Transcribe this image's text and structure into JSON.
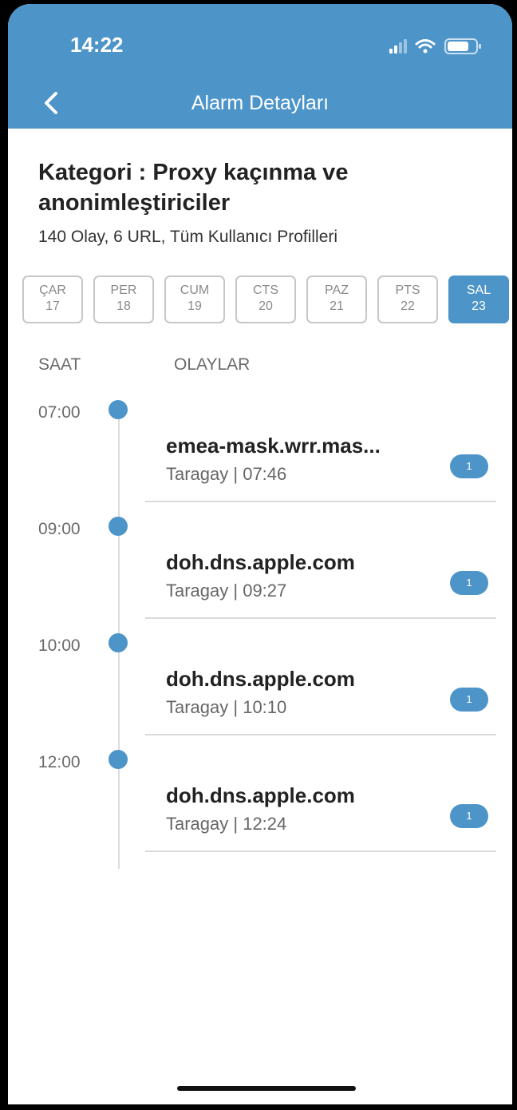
{
  "status_bar": {
    "time": "14:22"
  },
  "nav": {
    "title": "Alarm Detayları"
  },
  "category": {
    "title": "Kategori : Proxy kaçınma ve anonimleştiriciler",
    "summary": "140 Olay, 6 URL, Tüm Kullanıcı Profilleri"
  },
  "days": [
    {
      "name": "ÇAR",
      "num": "17",
      "selected": false
    },
    {
      "name": "PER",
      "num": "18",
      "selected": false
    },
    {
      "name": "CUM",
      "num": "19",
      "selected": false
    },
    {
      "name": "CTS",
      "num": "20",
      "selected": false
    },
    {
      "name": "PAZ",
      "num": "21",
      "selected": false
    },
    {
      "name": "PTS",
      "num": "22",
      "selected": false
    },
    {
      "name": "SAL",
      "num": "23",
      "selected": true
    }
  ],
  "columns": {
    "time": "SAAT",
    "events": "OLAYLAR"
  },
  "entries": [
    {
      "hour": "07:00",
      "domain": "emea-mask.wrr.mas...",
      "meta": "Taragay | 07:46",
      "count": "1"
    },
    {
      "hour": "09:00",
      "domain": "doh.dns.apple.com",
      "meta": "Taragay | 09:27",
      "count": "1"
    },
    {
      "hour": "10:00",
      "domain": "doh.dns.apple.com",
      "meta": "Taragay | 10:10",
      "count": "1"
    },
    {
      "hour": "12:00",
      "domain": "doh.dns.apple.com",
      "meta": "Taragay | 12:24",
      "count": "1"
    }
  ],
  "colors": {
    "accent": "#4d94c9"
  },
  "icons": {
    "back": "chevron-left-icon",
    "signal": "cellular-signal-icon",
    "wifi": "wifi-icon",
    "battery": "battery-icon"
  }
}
